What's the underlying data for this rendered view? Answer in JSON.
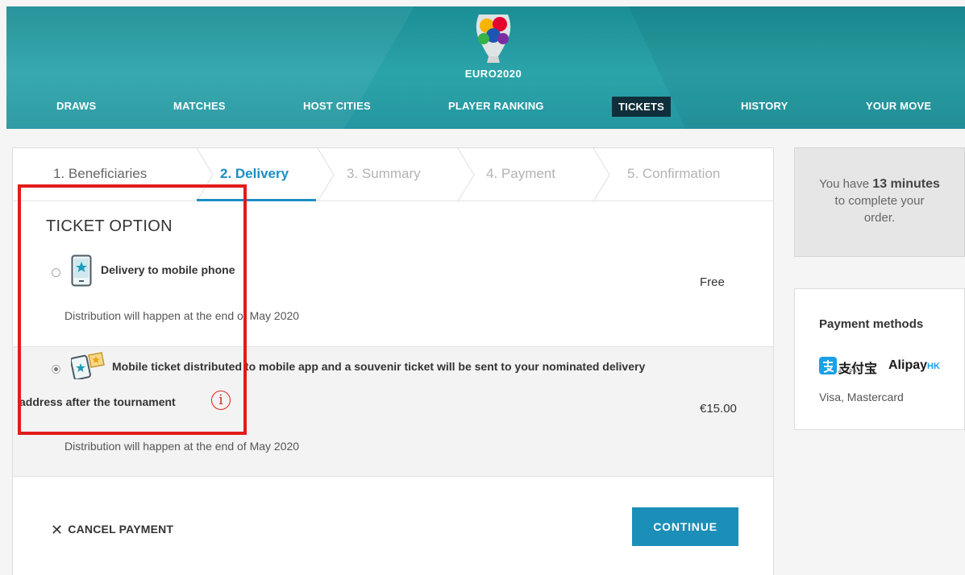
{
  "header": {
    "logo_text": "EURO2020",
    "nav": [
      {
        "label": "DRAWS"
      },
      {
        "label": "MATCHES"
      },
      {
        "label": "HOST CITIES"
      },
      {
        "label": "PLAYER RANKING"
      },
      {
        "label": "TICKETS",
        "active": true
      },
      {
        "label": "HISTORY"
      },
      {
        "label": "YOUR MOVE"
      }
    ]
  },
  "steps": [
    {
      "label": "1. Beneficiaries",
      "state": "done"
    },
    {
      "label": "2. Delivery",
      "state": "active"
    },
    {
      "label": "3. Summary",
      "state": "pending"
    },
    {
      "label": "4. Payment",
      "state": "pending"
    },
    {
      "label": "5. Confirmation",
      "state": "pending"
    }
  ],
  "ticket_option": {
    "title": "TICKET OPTION",
    "options": [
      {
        "label": "Delivery to mobile phone",
        "description": "Distribution will happen at the end of May 2020",
        "price": "Free",
        "selected": false,
        "icon": "mobile-phone-icon"
      },
      {
        "label_line1": "Mobile ticket distributed to mobile app and a souvenir ticket will be sent to your nominated delivery",
        "label_line2": "address after the tournament",
        "description": "Distribution will happen at the end of May 2020",
        "price": "€15.00",
        "selected": true,
        "icon": "mobile-souvenir-ticket-icon",
        "info_glyph": "i"
      }
    ]
  },
  "actions": {
    "cancel_label": "CANCEL PAYMENT",
    "continue_label": "CONTINUE"
  },
  "timer": {
    "prefix": "You have ",
    "minutes": "13 minutes",
    "suffix_line1": "to complete your",
    "suffix_line2": "order."
  },
  "payment": {
    "title": "Payment methods",
    "alipay_cn": "支付宝",
    "alipay_sub": "ALIPAY",
    "alipay_en": "Alipay",
    "alipay_hk": "HK",
    "cards": "Visa, Mastercard"
  },
  "colors": {
    "header": "#2ba4a9",
    "accent_blue": "#1b8ec4",
    "continue_button": "#1b8fb8",
    "annotation": "#e31b1b",
    "nav_active_bg": "#0f2f3a"
  }
}
